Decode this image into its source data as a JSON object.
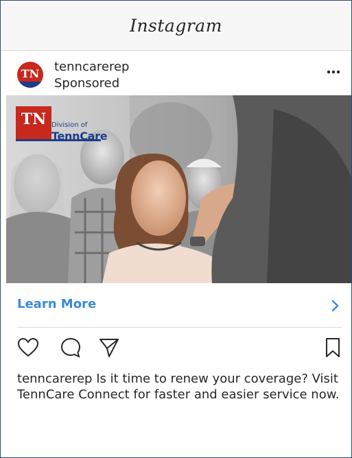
{
  "app": {
    "title": "Instagram"
  },
  "post": {
    "username": "tenncarerep",
    "sponsored_label": "Sponsored",
    "avatar_text": "TN",
    "media": {
      "logo_mark": "TN",
      "logo_division": "Division of",
      "logo_name": "TennCare"
    },
    "cta_label": "Learn More",
    "caption_user": "tenncarerep",
    "caption_text": " Is it time to renew your coverage? Visit TennCare Connect for faster and easier service now."
  },
  "colors": {
    "link": "#3b8ad9",
    "brand_red": "#c8281e",
    "brand_blue": "#1c3e8a"
  },
  "icons": [
    "more-icon",
    "chevron-right-icon",
    "heart-icon",
    "comment-icon",
    "share-icon",
    "bookmark-icon"
  ]
}
